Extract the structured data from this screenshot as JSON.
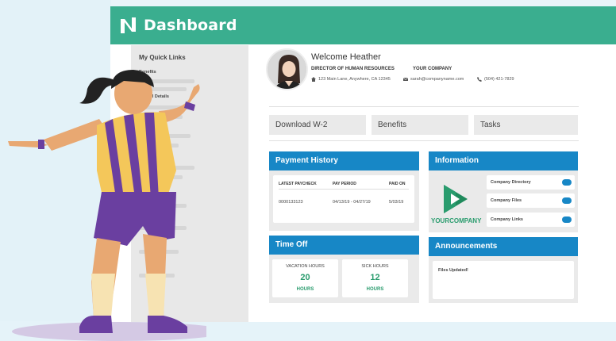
{
  "header": {
    "title": "Dashboard",
    "logo_icon": "n-logo-icon"
  },
  "sidebar": {
    "title": "My Quick Links",
    "items": [
      {
        "label": "Benefits"
      },
      {
        "label": "Payroll Details"
      }
    ]
  },
  "profile": {
    "welcome": "Welcome Heather",
    "role": "DIRECTOR OF HUMAN RESOURCES",
    "company": "YOUR COMPANY",
    "address": "123 Main Lane, Anywhere, CA 12345",
    "email": "sarah@companyname.com",
    "phone": "(504) 421-7829"
  },
  "quick_buttons": [
    {
      "label": "Download W-2"
    },
    {
      "label": "Benefits"
    },
    {
      "label": "Tasks"
    }
  ],
  "payment_history": {
    "title": "Payment History",
    "columns": [
      "LATEST PAYCHECK",
      "PAY PERIOD",
      "PAID ON"
    ],
    "row": [
      "0000133123",
      "04/13/19 - 04/27/19",
      "5/03/19"
    ]
  },
  "time_off": {
    "title": "Time Off",
    "vacation": {
      "label": "VACATION HOURS",
      "value": "20",
      "unit": "HOURS"
    },
    "sick": {
      "label": "SICK HOURS",
      "value": "12",
      "unit": "HOURS"
    }
  },
  "information": {
    "title": "Information",
    "company_logo_text": "YOURCOMPANY",
    "links": [
      {
        "label": "Company Directory",
        "enabled": true
      },
      {
        "label": "Company Files",
        "enabled": true
      },
      {
        "label": "Company Links",
        "enabled": true
      }
    ]
  },
  "announcements": {
    "title": "Announcements",
    "text": "Files Updated!"
  },
  "colors": {
    "header": "#3aae8f",
    "panel_header": "#1787c6",
    "accent_green": "#2a9c6e",
    "jersey_purple": "#6a3fa0",
    "jersey_yellow": "#f4c75a"
  }
}
